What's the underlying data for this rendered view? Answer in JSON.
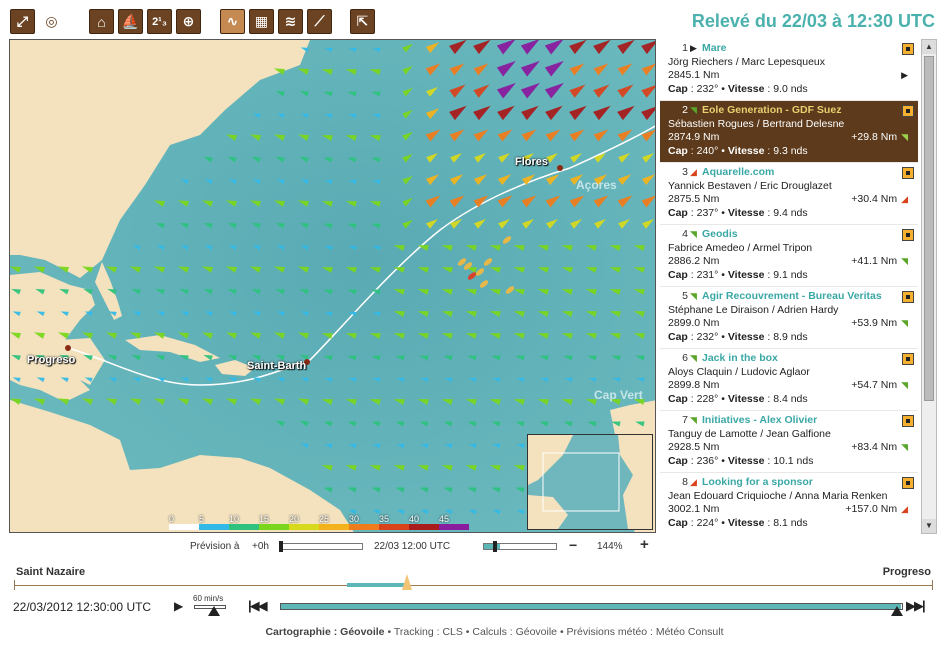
{
  "header": {
    "title": "Relevé du 22/03 à 12:30 UTC"
  },
  "toolbar": {
    "tools": [
      {
        "name": "fullscreen-icon"
      },
      {
        "name": "globe-icon"
      },
      {
        "name": "home-icon"
      },
      {
        "name": "sailboat-icon"
      },
      {
        "name": "ranking-icon"
      },
      {
        "name": "zoom-add-icon"
      },
      {
        "name": "track-icon"
      },
      {
        "name": "grid-icon"
      },
      {
        "name": "wind-icon"
      },
      {
        "name": "ruler-icon"
      },
      {
        "name": "expand-icon"
      }
    ],
    "rank_glyph": "2¹₃"
  },
  "map": {
    "places": {
      "flores": "Flores",
      "acores": "Açores",
      "progreso": "Progreso",
      "saint_barth": "Saint-Barth",
      "cap_vert": "Cap Vert"
    }
  },
  "legend": {
    "labels": [
      "0",
      "5",
      "10",
      "15",
      "20",
      "25",
      "30",
      "35",
      "40",
      "45"
    ],
    "colors": [
      "#ffffff",
      "#33b9e8",
      "#2ec27e",
      "#7ad61c",
      "#d7d91c",
      "#f2b21c",
      "#ef7c1c",
      "#d8431c",
      "#a81c1c",
      "#8a1c9e"
    ]
  },
  "prevision": {
    "label": "Prévision à",
    "hours": "+0h",
    "date": "22/03 12:00 UTC",
    "zoom": "144%",
    "zoom_minus": "−",
    "zoom_plus": "+"
  },
  "boats": [
    {
      "rank": "1",
      "name": "Mare",
      "skippers": "Jörg Riechers / Marc Lepesqueux",
      "distance": "2845.1 Nm",
      "delta": "",
      "cap": "232°",
      "vitesse": "9.0 nds",
      "cap_label": "Cap",
      "vit_label": "Vitesse",
      "trend": "leader"
    },
    {
      "rank": "2",
      "name": "Eole Generation - GDF Suez",
      "skippers": "Sébastien Rogues / Bertrand Delesne",
      "distance": "2874.9 Nm",
      "delta": "+29.8 Nm",
      "cap": "240°",
      "vitesse": "9.3 nds",
      "cap_label": "Cap",
      "vit_label": "Vitesse",
      "trend": "up"
    },
    {
      "rank": "3",
      "name": "Aquarelle.com",
      "skippers": "Yannick Bestaven / Eric Drouglazet",
      "distance": "2875.5 Nm",
      "delta": "+30.4 Nm",
      "cap": "237°",
      "vitesse": "9.4 nds",
      "cap_label": "Cap",
      "vit_label": "Vitesse",
      "trend": "down"
    },
    {
      "rank": "4",
      "name": "Geodis",
      "skippers": "Fabrice Amedeo / Armel Tripon",
      "distance": "2886.2 Nm",
      "delta": "+41.1 Nm",
      "cap": "231°",
      "vitesse": "9.1 nds",
      "cap_label": "Cap",
      "vit_label": "Vitesse",
      "trend": "up"
    },
    {
      "rank": "5",
      "name": "Agir Recouvrement - Bureau Veritas",
      "skippers": "Stéphane Le Diraison / Adrien Hardy",
      "distance": "2899.0 Nm",
      "delta": "+53.9 Nm",
      "cap": "232°",
      "vitesse": "8.9 nds",
      "cap_label": "Cap",
      "vit_label": "Vitesse",
      "trend": "up"
    },
    {
      "rank": "6",
      "name": "Jack in the box",
      "skippers": "Aloys Claquin / Ludovic Aglaor",
      "distance": "2899.8 Nm",
      "delta": "+54.7 Nm",
      "cap": "228°",
      "vitesse": "8.4 nds",
      "cap_label": "Cap",
      "vit_label": "Vitesse",
      "trend": "up"
    },
    {
      "rank": "7",
      "name": "Initiatives - Alex Olivier",
      "skippers": "Tanguy de Lamotte / Jean Galfione",
      "distance": "2928.5 Nm",
      "delta": "+83.4 Nm",
      "cap": "236°",
      "vitesse": "10.1 nds",
      "cap_label": "Cap",
      "vit_label": "Vitesse",
      "trend": "up"
    },
    {
      "rank": "8",
      "name": "Looking for a sponsor",
      "skippers": "Jean Edouard Criquioche / Anna Maria Renken",
      "distance": "3002.1 Nm",
      "delta": "+157.0 Nm",
      "cap": "224°",
      "vitesse": "8.1 nds",
      "cap_label": "Cap",
      "vit_label": "Vitesse",
      "trend": "down"
    }
  ],
  "timeline": {
    "start": "Saint Nazaire",
    "end": "Progreso",
    "datetime": "22/03/2012 12:30:00 UTC",
    "speed": "60 min/s",
    "progress": 0.43
  },
  "credits": {
    "carto_label": "Cartographie :",
    "carto": "Géovoile",
    "rest": "• Tracking : CLS • Calculs : Géovoile • Prévisions météo : Météo Consult"
  }
}
